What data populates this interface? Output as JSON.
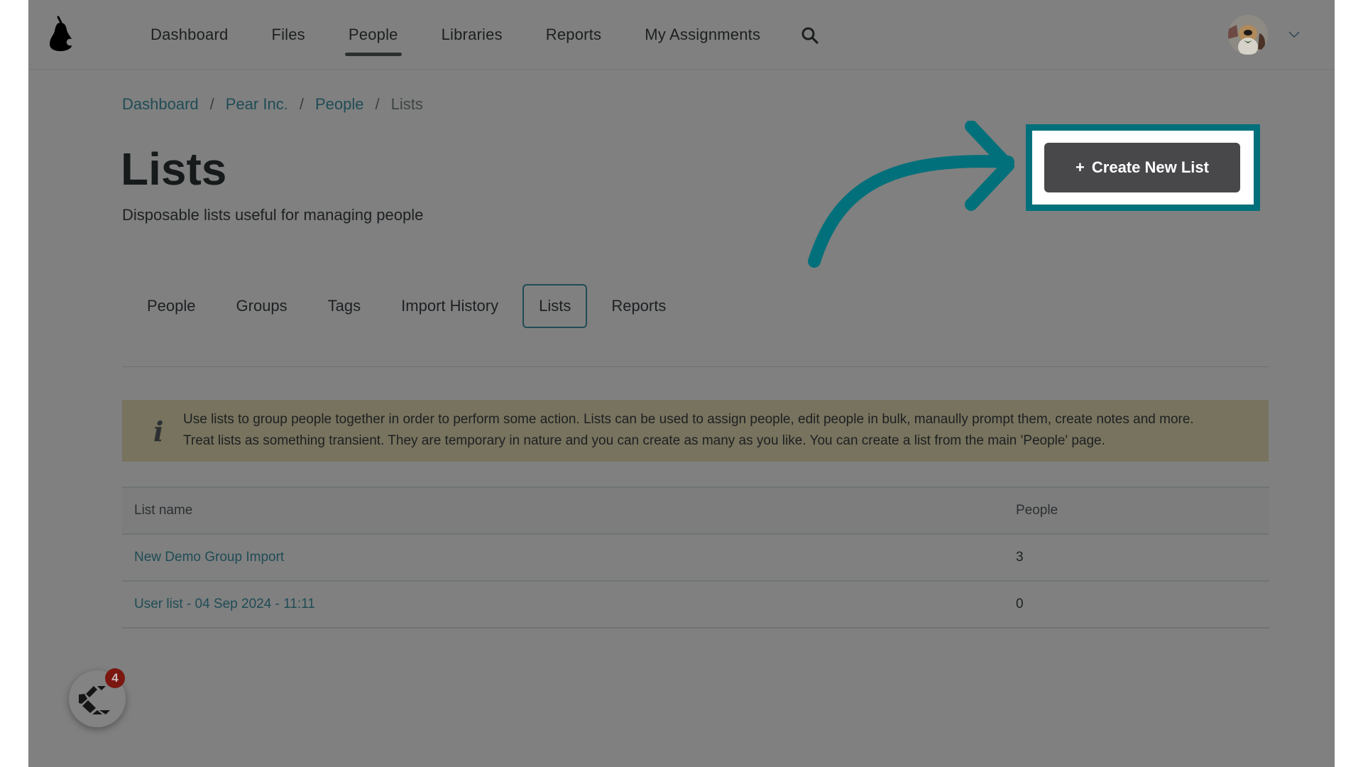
{
  "header": {
    "logo": "pear-logo",
    "nav": [
      {
        "label": "Dashboard",
        "active": false
      },
      {
        "label": "Files",
        "active": false
      },
      {
        "label": "People",
        "active": true
      },
      {
        "label": "Libraries",
        "active": false
      },
      {
        "label": "Reports",
        "active": false
      },
      {
        "label": "My Assignments",
        "active": false
      }
    ],
    "search_icon": "search-icon",
    "avatar_alt": "user avatar",
    "menu_icon": "chevron-down-icon"
  },
  "breadcrumb": [
    {
      "label": "Dashboard",
      "link": true
    },
    {
      "label": "Pear Inc.",
      "link": true
    },
    {
      "label": "People",
      "link": true
    },
    {
      "label": "Lists",
      "link": false
    }
  ],
  "breadcrumb_separator": "/",
  "page": {
    "title": "Lists",
    "subtitle": "Disposable lists useful for managing people"
  },
  "actions": {
    "create_icon": "+",
    "create_label": "Create New List"
  },
  "annotation": {
    "highlight_color": "#02707b"
  },
  "tabs": [
    {
      "label": "People",
      "active": false
    },
    {
      "label": "Groups",
      "active": false
    },
    {
      "label": "Tags",
      "active": false
    },
    {
      "label": "Import History",
      "active": false
    },
    {
      "label": "Lists",
      "active": true
    },
    {
      "label": "Reports",
      "active": false
    }
  ],
  "info": {
    "icon": "i",
    "line1": "Use lists to group people together in order to perform some action. Lists can be used to assign people, edit people in bulk, manaully prompt them, create notes and more.",
    "line2": "Treat lists as something transient. They are temporary in nature and you can create as many as you like. You can create a list from the main 'People' page."
  },
  "table": {
    "columns": [
      "List name",
      "People"
    ],
    "rows": [
      {
        "name": "New Demo Group Import",
        "people": "3"
      },
      {
        "name": "User list - 04 Sep 2024 - 11:11",
        "people": "0"
      }
    ]
  },
  "chat_widget": {
    "badge_count": "4"
  },
  "colors": {
    "accent": "#02707b",
    "link": "#1f4c55",
    "button_bg": "#48484a",
    "info_bg": "#78735e",
    "badge": "#7a1710"
  }
}
